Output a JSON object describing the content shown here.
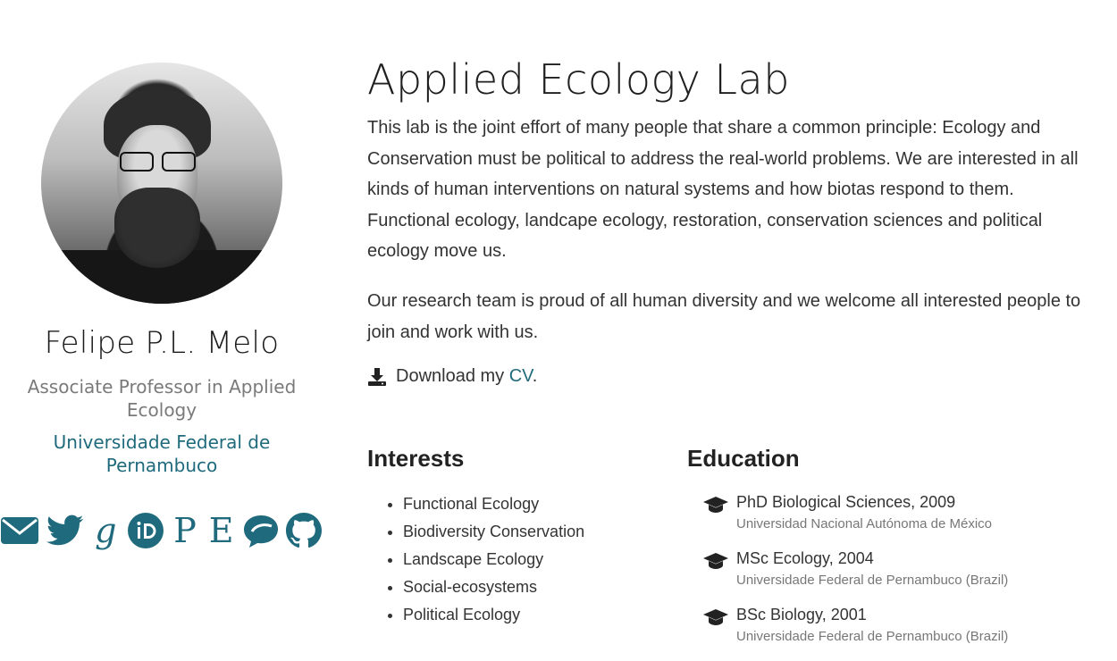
{
  "profile": {
    "name": "Felipe P.L. Melo",
    "role": "Associate Professor in Applied Ecology",
    "organization": "Universidade Federal de Pernambuco",
    "social": [
      {
        "icon": "envelope-icon"
      },
      {
        "icon": "twitter-icon"
      },
      {
        "icon": "google-scholar-icon",
        "glyph": "g"
      },
      {
        "icon": "orcid-icon"
      },
      {
        "icon": "publons-icon",
        "glyph": "P"
      },
      {
        "icon": "europepmc-icon",
        "glyph": "E"
      },
      {
        "icon": "researchgate-speech-icon"
      },
      {
        "icon": "github-icon"
      }
    ]
  },
  "main": {
    "title": "Applied Ecology Lab",
    "bio": [
      "This lab is the joint effort of many people that share a common principle: Ecology and Conservation must be political to address the real-world problems. We are interested in all kinds of human interventions on natural systems and how biotas respond to them. Functional ecology, landcape ecology, restoration, conservation sciences and political ecology move us.",
      "Our research team is proud of all human diversity and we welcome all interested people to join and work with us."
    ],
    "cv_prefix": "Download my",
    "cv_link": "CV",
    "cv_suffix": "."
  },
  "interests": {
    "heading": "Interests",
    "items": [
      "Functional Ecology",
      "Biodiversity Conservation",
      "Landscape Ecology",
      "Social-ecosystems",
      "Political Ecology"
    ]
  },
  "education": {
    "heading": "Education",
    "items": [
      {
        "degree": "PhD Biological Sciences, 2009",
        "institution": "Universidad Nacional Autónoma de México"
      },
      {
        "degree": "MSc Ecology, 2004",
        "institution": "Universidade Federal de Pernambuco (Brazil)"
      },
      {
        "degree": "BSc Biology, 2001",
        "institution": "Universidade Federal de Pernambuco (Brazil)"
      }
    ]
  },
  "colors": {
    "accent": "#1f6a7c",
    "muted": "#7a7a7a"
  }
}
